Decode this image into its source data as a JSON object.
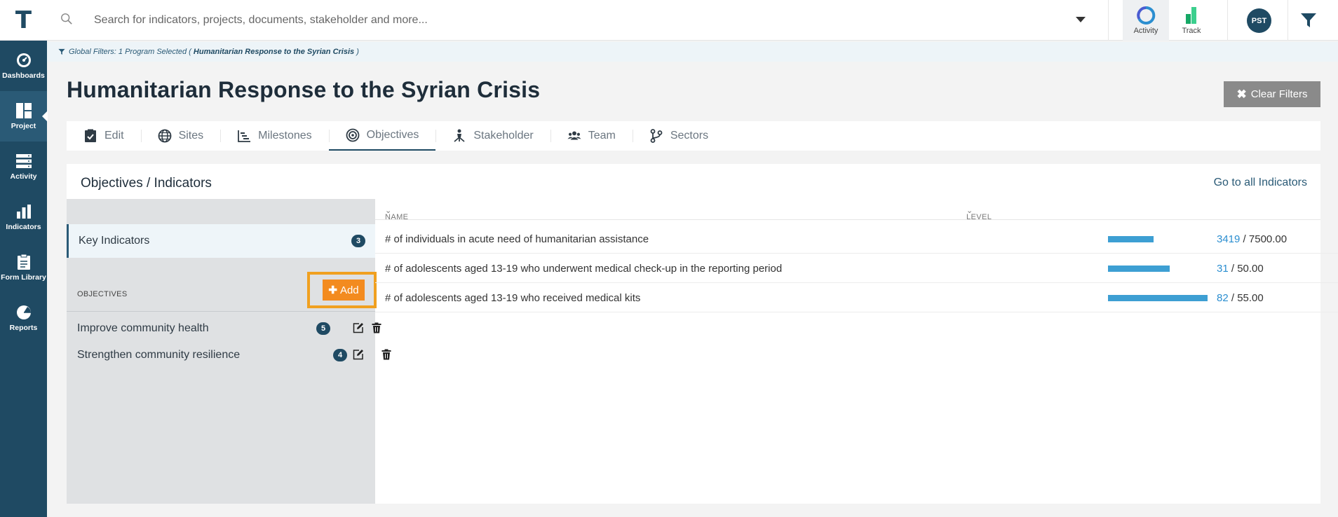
{
  "topbar": {
    "logo": "T",
    "search_placeholder": "Search for indicators, projects, documents, stakeholder and more...",
    "apps": [
      {
        "label": "Activity",
        "icon": "activity-ring-icon"
      },
      {
        "label": "Track",
        "icon": "track-bars-icon"
      }
    ],
    "user_initials": "PST"
  },
  "sidebar": {
    "items": [
      {
        "label": "Dashboards",
        "icon": "speedometer-icon"
      },
      {
        "label": "Project",
        "icon": "project-grid-icon",
        "active": true
      },
      {
        "label": "Activity",
        "icon": "server-stack-icon"
      },
      {
        "label": "Indicators",
        "icon": "bar-chart-icon"
      },
      {
        "label": "Form Library",
        "icon": "clipboard-icon"
      },
      {
        "label": "Reports",
        "icon": "pie-chart-icon"
      }
    ]
  },
  "global_filters": {
    "prefix": "Global Filters: 1 Program Selected (",
    "program": "Humanitarian Response to the Syrian Crisis",
    "suffix": ")"
  },
  "page": {
    "title": "Humanitarian Response to the Syrian Crisis",
    "clear_filters": "Clear Filters"
  },
  "tabs": [
    {
      "label": "Edit",
      "icon": "clipboard-check-icon"
    },
    {
      "label": "Sites",
      "icon": "globe-icon"
    },
    {
      "label": "Milestones",
      "icon": "chart-steps-icon"
    },
    {
      "label": "Objectives",
      "icon": "target-icon",
      "active": true
    },
    {
      "label": "Stakeholder",
      "icon": "sitemap-icon"
    },
    {
      "label": "Team",
      "icon": "users-icon"
    },
    {
      "label": "Sectors",
      "icon": "branch-icon"
    }
  ],
  "panel": {
    "title": "Objectives / Indicators",
    "goto_link": "Go to all Indicators",
    "key_indicators": {
      "label": "Key Indicators",
      "count": "3"
    },
    "objectives_header": "OBJECTIVES",
    "add_label": "Add",
    "objectives": [
      {
        "label": "Improve community health",
        "count": "5"
      },
      {
        "label": "Strengthen community resilience",
        "count": "4"
      }
    ],
    "columns": {
      "name": "NAME",
      "level": "LEVEL"
    },
    "indicators": [
      {
        "name": "# of individuals in acute need of humanitarian assistance",
        "actual": "3419",
        "target": "/ 7500.00",
        "progress": 0.4559
      },
      {
        "name": "# of adolescents aged 13-19 who underwent medical check-up in the reporting period",
        "actual": "31",
        "target": "/ 50.00",
        "progress": 0.62
      },
      {
        "name": "# of adolescents aged 13-19 who received medical kits",
        "actual": "82",
        "target": "/ 55.00",
        "progress": 1.0
      }
    ]
  },
  "colors": {
    "brand": "#1f4a63",
    "accent_orange": "#f38b1f",
    "progress_blue": "#3d9fd3"
  }
}
